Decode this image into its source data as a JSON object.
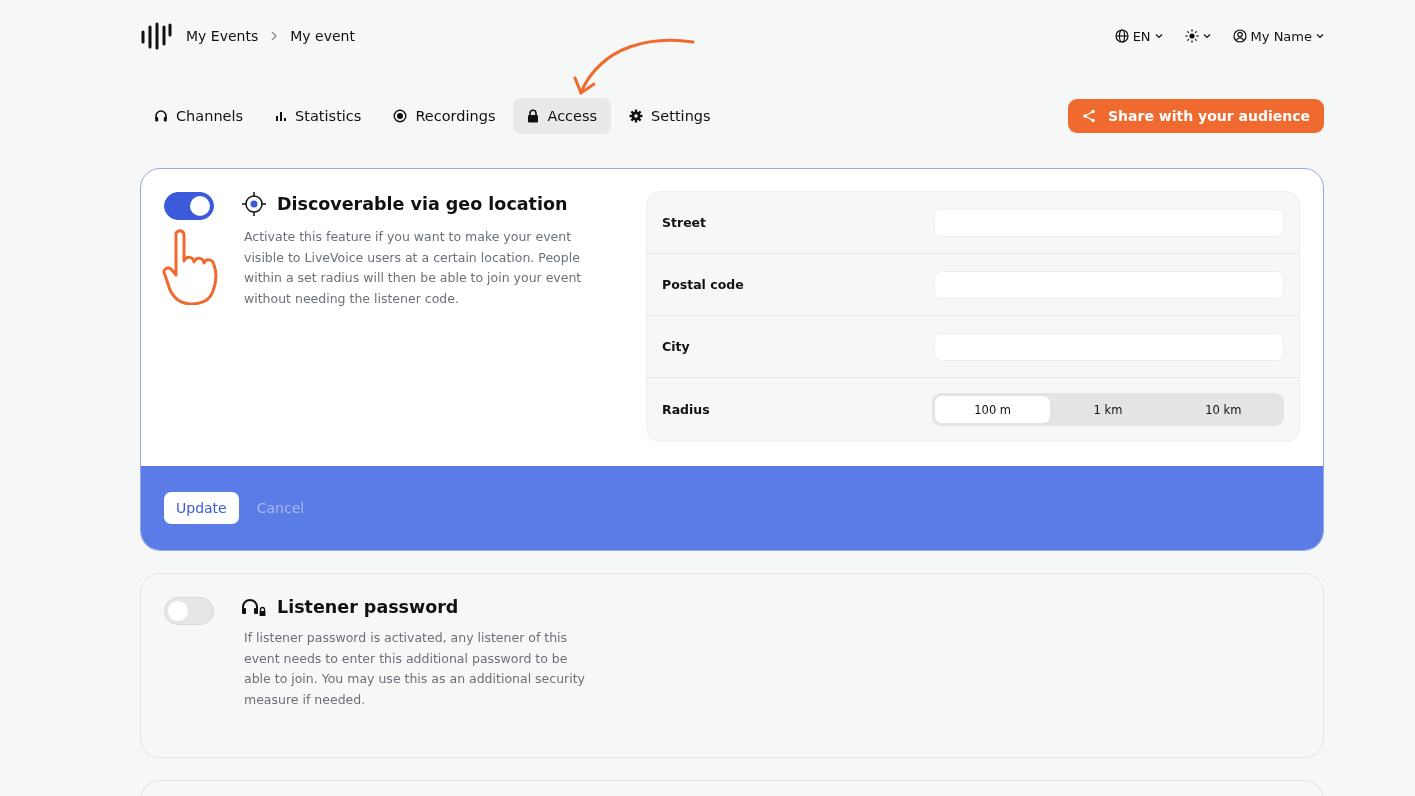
{
  "breadcrumb": [
    "My Events",
    "My event"
  ],
  "topbar": {
    "language": "EN",
    "user": "My Name"
  },
  "tabs": [
    {
      "label": "Channels",
      "kind": "headphones",
      "selected": false
    },
    {
      "label": "Statistics",
      "kind": "statistics",
      "selected": false
    },
    {
      "label": "Recordings",
      "kind": "recordings",
      "selected": false
    },
    {
      "label": "Access",
      "kind": "access",
      "selected": true
    },
    {
      "label": "Settings",
      "kind": "settings",
      "selected": false
    }
  ],
  "share_button": "Share with your audience",
  "sections": [
    {
      "kind": "geo",
      "title": "Discoverable via geo location",
      "enabled": true,
      "description": "Activate this feature if you want to make your event visible to LiveVoice users at a certain location. People within a set radius will then be able to join your event without needing the listener code.",
      "fields": [
        {
          "label": "Street"
        },
        {
          "label": "Postal code"
        },
        {
          "label": "City"
        }
      ],
      "radius": {
        "label": "Radius",
        "options": [
          {
            "label": "100 m",
            "selected": true
          },
          {
            "label": "1 km",
            "selected": false
          },
          {
            "label": "10 km",
            "selected": false
          }
        ]
      },
      "actions": {
        "update": "Update",
        "cancel": "Cancel"
      }
    },
    {
      "kind": "password",
      "title": "Listener password",
      "enabled": false,
      "description": "If listener password is activated, any listener of this event needs to enter this additional password to be able to join. You may use this as an additional security measure if needed."
    }
  ]
}
